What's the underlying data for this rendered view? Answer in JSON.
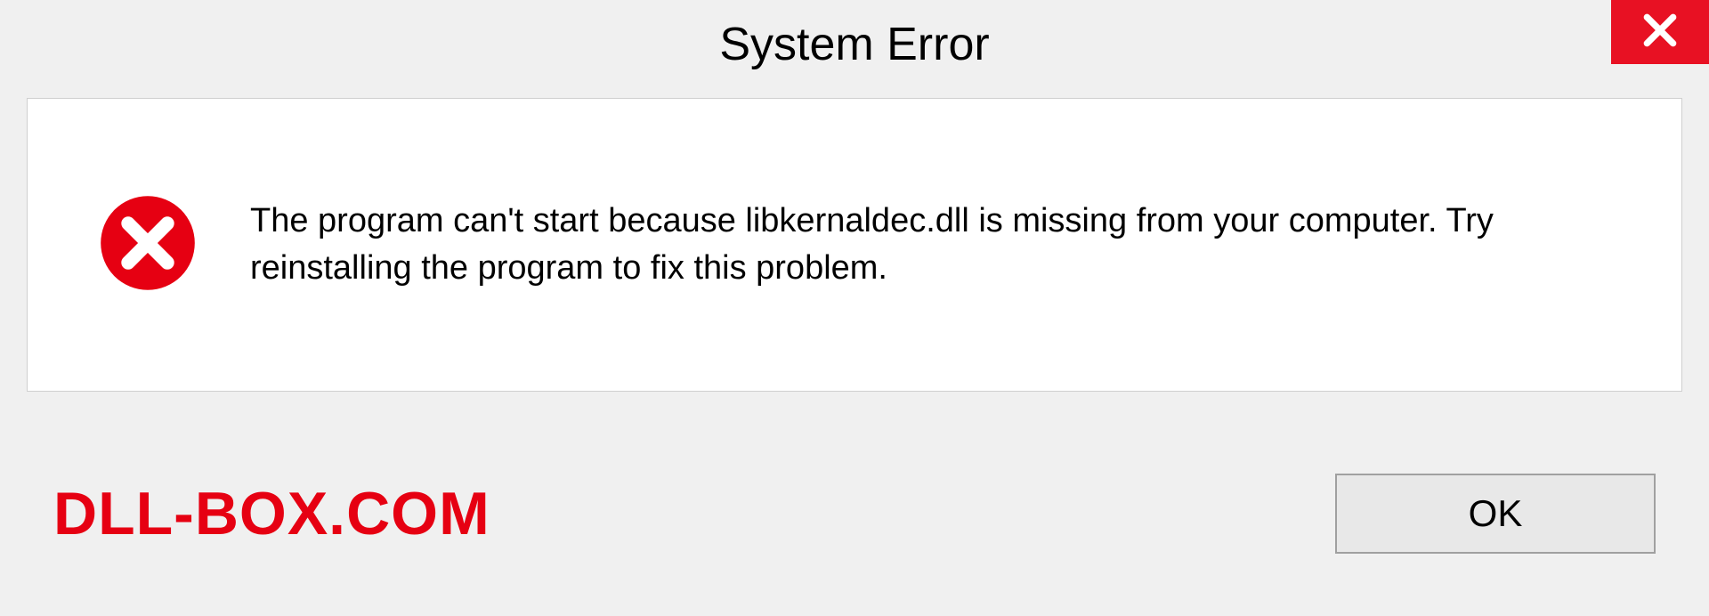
{
  "title": "System Error",
  "message": "The program can't start because libkernaldec.dll is missing from your computer. Try reinstalling the program to fix this problem.",
  "watermark": "DLL-BOX.COM",
  "ok_label": "OK"
}
